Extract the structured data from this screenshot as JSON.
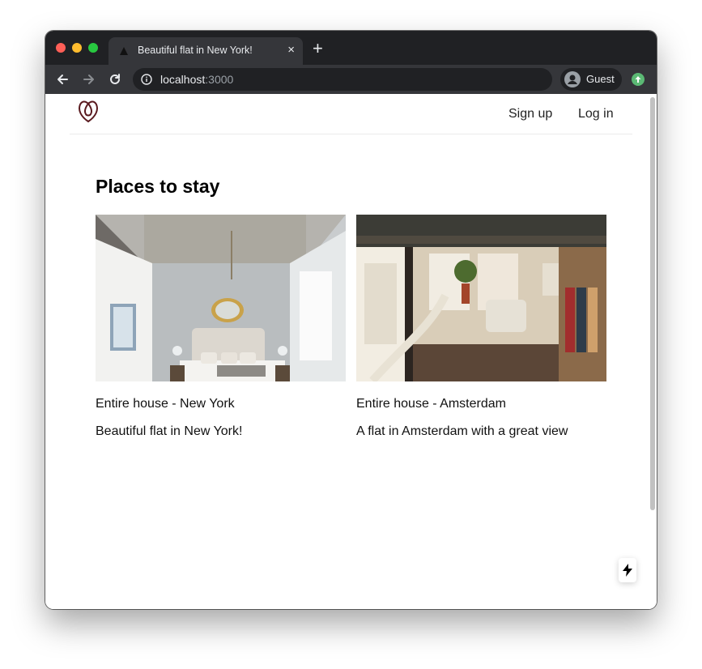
{
  "browser": {
    "tab_title": "Beautiful flat in New York!",
    "tab_close_glyph": "×",
    "new_tab_glyph": "+",
    "url_host": "localhost",
    "url_port": ":3000",
    "profile_label": "Guest",
    "icons": [
      "back-icon",
      "forward-icon",
      "reload-icon",
      "info-icon",
      "avatar-icon",
      "update-icon"
    ]
  },
  "header": {
    "signup_label": "Sign up",
    "login_label": "Log in",
    "brand_color": "#5a1a1f"
  },
  "main": {
    "title": "Places to stay",
    "listings": [
      {
        "type": "Entire house - New York",
        "title": "Beautiful flat in New York!"
      },
      {
        "type": "Entire house - Amsterdam",
        "title": "A flat in Amsterdam with a great view"
      }
    ]
  }
}
